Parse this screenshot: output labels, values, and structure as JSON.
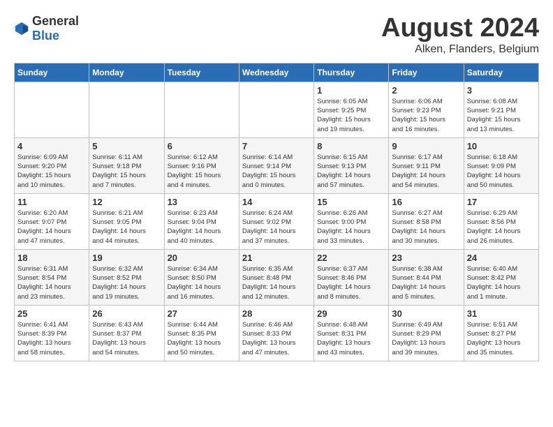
{
  "header": {
    "logo_general": "General",
    "logo_blue": "Blue",
    "title": "August 2024",
    "subtitle": "Alken, Flanders, Belgium"
  },
  "weekdays": [
    "Sunday",
    "Monday",
    "Tuesday",
    "Wednesday",
    "Thursday",
    "Friday",
    "Saturday"
  ],
  "weeks": [
    [
      {
        "day": "",
        "info": ""
      },
      {
        "day": "",
        "info": ""
      },
      {
        "day": "",
        "info": ""
      },
      {
        "day": "",
        "info": ""
      },
      {
        "day": "1",
        "info": "Sunrise: 6:05 AM\nSunset: 9:25 PM\nDaylight: 15 hours\nand 19 minutes."
      },
      {
        "day": "2",
        "info": "Sunrise: 6:06 AM\nSunset: 9:23 PM\nDaylight: 15 hours\nand 16 minutes."
      },
      {
        "day": "3",
        "info": "Sunrise: 6:08 AM\nSunset: 9:21 PM\nDaylight: 15 hours\nand 13 minutes."
      }
    ],
    [
      {
        "day": "4",
        "info": "Sunrise: 6:09 AM\nSunset: 9:20 PM\nDaylight: 15 hours\nand 10 minutes."
      },
      {
        "day": "5",
        "info": "Sunrise: 6:11 AM\nSunset: 9:18 PM\nDaylight: 15 hours\nand 7 minutes."
      },
      {
        "day": "6",
        "info": "Sunrise: 6:12 AM\nSunset: 9:16 PM\nDaylight: 15 hours\nand 4 minutes."
      },
      {
        "day": "7",
        "info": "Sunrise: 6:14 AM\nSunset: 9:14 PM\nDaylight: 15 hours\nand 0 minutes."
      },
      {
        "day": "8",
        "info": "Sunrise: 6:15 AM\nSunset: 9:13 PM\nDaylight: 14 hours\nand 57 minutes."
      },
      {
        "day": "9",
        "info": "Sunrise: 6:17 AM\nSunset: 9:11 PM\nDaylight: 14 hours\nand 54 minutes."
      },
      {
        "day": "10",
        "info": "Sunrise: 6:18 AM\nSunset: 9:09 PM\nDaylight: 14 hours\nand 50 minutes."
      }
    ],
    [
      {
        "day": "11",
        "info": "Sunrise: 6:20 AM\nSunset: 9:07 PM\nDaylight: 14 hours\nand 47 minutes."
      },
      {
        "day": "12",
        "info": "Sunrise: 6:21 AM\nSunset: 9:05 PM\nDaylight: 14 hours\nand 44 minutes."
      },
      {
        "day": "13",
        "info": "Sunrise: 6:23 AM\nSunset: 9:04 PM\nDaylight: 14 hours\nand 40 minutes."
      },
      {
        "day": "14",
        "info": "Sunrise: 6:24 AM\nSunset: 9:02 PM\nDaylight: 14 hours\nand 37 minutes."
      },
      {
        "day": "15",
        "info": "Sunrise: 6:26 AM\nSunset: 9:00 PM\nDaylight: 14 hours\nand 33 minutes."
      },
      {
        "day": "16",
        "info": "Sunrise: 6:27 AM\nSunset: 8:58 PM\nDaylight: 14 hours\nand 30 minutes."
      },
      {
        "day": "17",
        "info": "Sunrise: 6:29 AM\nSunset: 8:56 PM\nDaylight: 14 hours\nand 26 minutes."
      }
    ],
    [
      {
        "day": "18",
        "info": "Sunrise: 6:31 AM\nSunset: 8:54 PM\nDaylight: 14 hours\nand 23 minutes."
      },
      {
        "day": "19",
        "info": "Sunrise: 6:32 AM\nSunset: 8:52 PM\nDaylight: 14 hours\nand 19 minutes."
      },
      {
        "day": "20",
        "info": "Sunrise: 6:34 AM\nSunset: 8:50 PM\nDaylight: 14 hours\nand 16 minutes."
      },
      {
        "day": "21",
        "info": "Sunrise: 6:35 AM\nSunset: 8:48 PM\nDaylight: 14 hours\nand 12 minutes."
      },
      {
        "day": "22",
        "info": "Sunrise: 6:37 AM\nSunset: 8:46 PM\nDaylight: 14 hours\nand 8 minutes."
      },
      {
        "day": "23",
        "info": "Sunrise: 6:38 AM\nSunset: 8:44 PM\nDaylight: 14 hours\nand 5 minutes."
      },
      {
        "day": "24",
        "info": "Sunrise: 6:40 AM\nSunset: 8:42 PM\nDaylight: 14 hours\nand 1 minute."
      }
    ],
    [
      {
        "day": "25",
        "info": "Sunrise: 6:41 AM\nSunset: 8:39 PM\nDaylight: 13 hours\nand 58 minutes."
      },
      {
        "day": "26",
        "info": "Sunrise: 6:43 AM\nSunset: 8:37 PM\nDaylight: 13 hours\nand 54 minutes."
      },
      {
        "day": "27",
        "info": "Sunrise: 6:44 AM\nSunset: 8:35 PM\nDaylight: 13 hours\nand 50 minutes."
      },
      {
        "day": "28",
        "info": "Sunrise: 6:46 AM\nSunset: 8:33 PM\nDaylight: 13 hours\nand 47 minutes."
      },
      {
        "day": "29",
        "info": "Sunrise: 6:48 AM\nSunset: 8:31 PM\nDaylight: 13 hours\nand 43 minutes."
      },
      {
        "day": "30",
        "info": "Sunrise: 6:49 AM\nSunset: 8:29 PM\nDaylight: 13 hours\nand 39 minutes."
      },
      {
        "day": "31",
        "info": "Sunrise: 6:51 AM\nSunset: 8:27 PM\nDaylight: 13 hours\nand 35 minutes."
      }
    ]
  ]
}
